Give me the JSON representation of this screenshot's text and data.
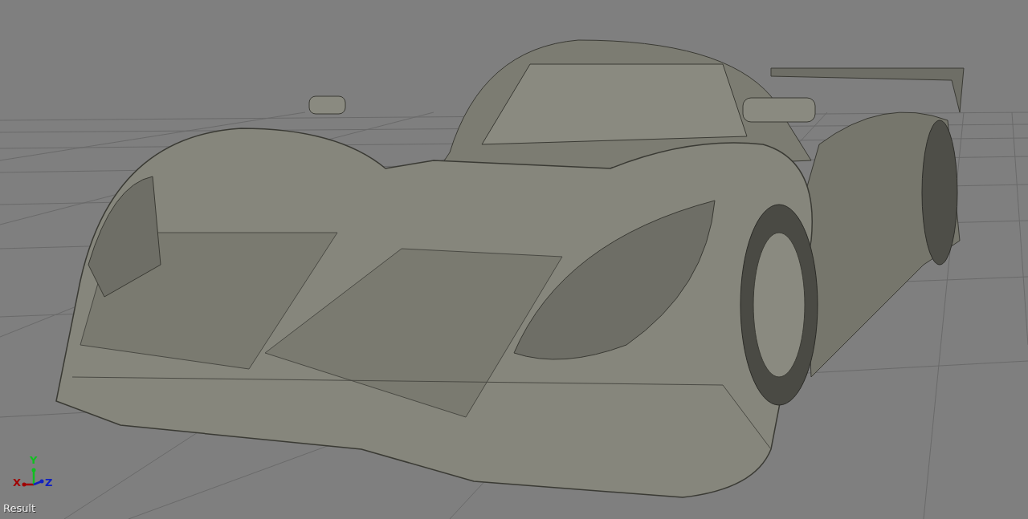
{
  "viewport": {
    "label": "Result"
  },
  "axes": [
    {
      "label": "X",
      "color": "#a00000",
      "kind": "x"
    },
    {
      "label": "Y",
      "color": "#10c020",
      "kind": "y"
    },
    {
      "label": "Z",
      "color": "#1020c0",
      "kind": "z"
    }
  ]
}
